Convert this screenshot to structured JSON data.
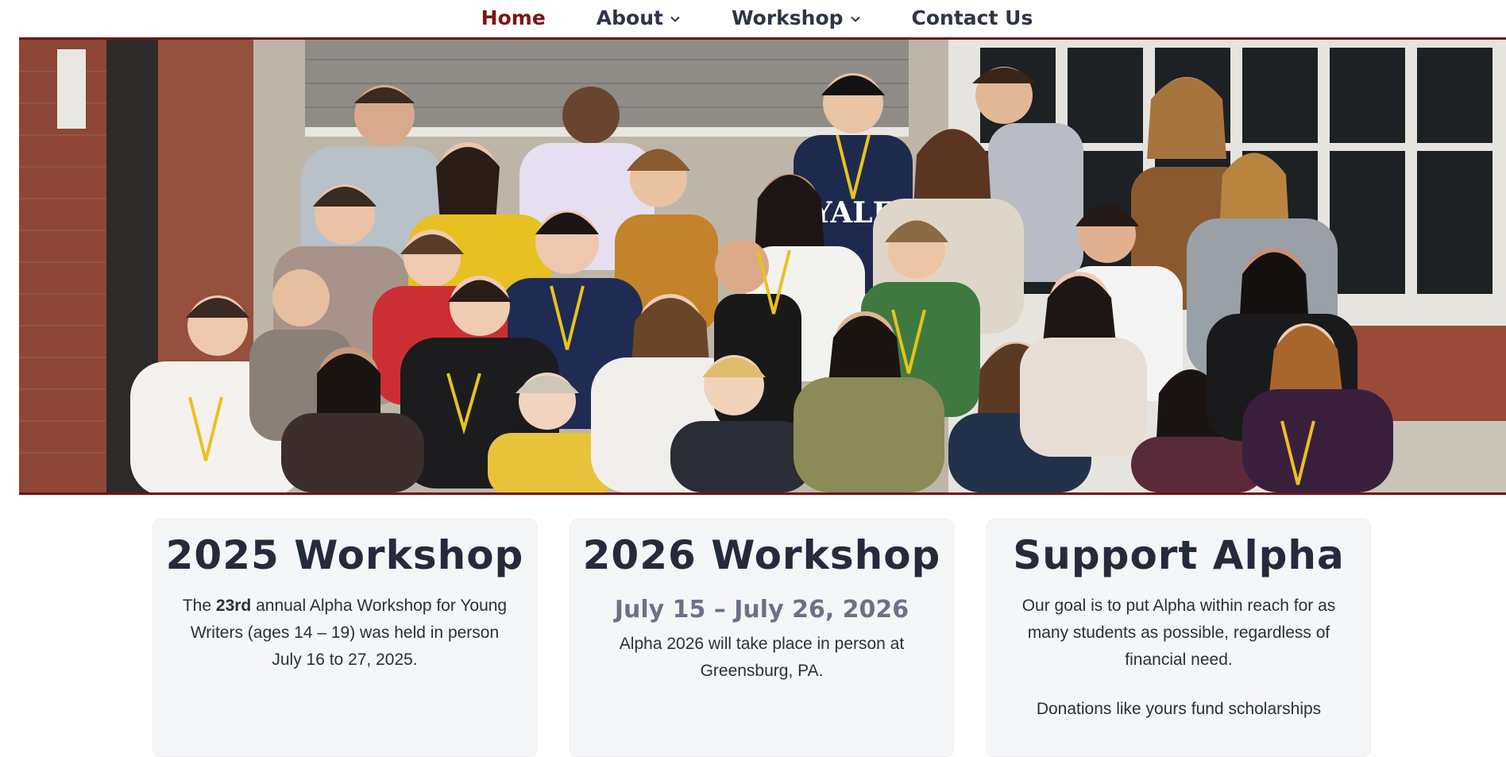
{
  "nav": {
    "items": [
      {
        "label": "Home",
        "active": true
      },
      {
        "label": "About",
        "dropdown": true
      },
      {
        "label": "Workshop",
        "dropdown": true
      },
      {
        "label": "Contact Us"
      }
    ]
  },
  "hero": {
    "alt": "Group photo of Alpha Workshop participants",
    "yale_text": "YALE"
  },
  "cards": {
    "workshop2025": {
      "title": "2025 Workshop",
      "text_prefix": "The ",
      "text_bold": "23rd",
      "text_suffix": " annual Alpha Workshop for Young Writers (ages 14 – 19) was held in person",
      "dates": "July 16 to 27, 2025."
    },
    "workshop2026": {
      "title": "2026 Workshop",
      "dates": "July 15 – July 26, 2026",
      "text": "Alpha 2026 will take place in person at Greensburg, PA."
    },
    "support": {
      "title": "Support Alpha",
      "text": "Our goal is to put Alpha within reach for as many students as possible, regardless of financial need.",
      "tail": "Donations like yours fund scholarships"
    }
  },
  "colors": {
    "accent": "#7b1716",
    "nav_text": "#2f3547",
    "card_bg": "#f5f6f8",
    "subtitle": "#6b7286"
  }
}
